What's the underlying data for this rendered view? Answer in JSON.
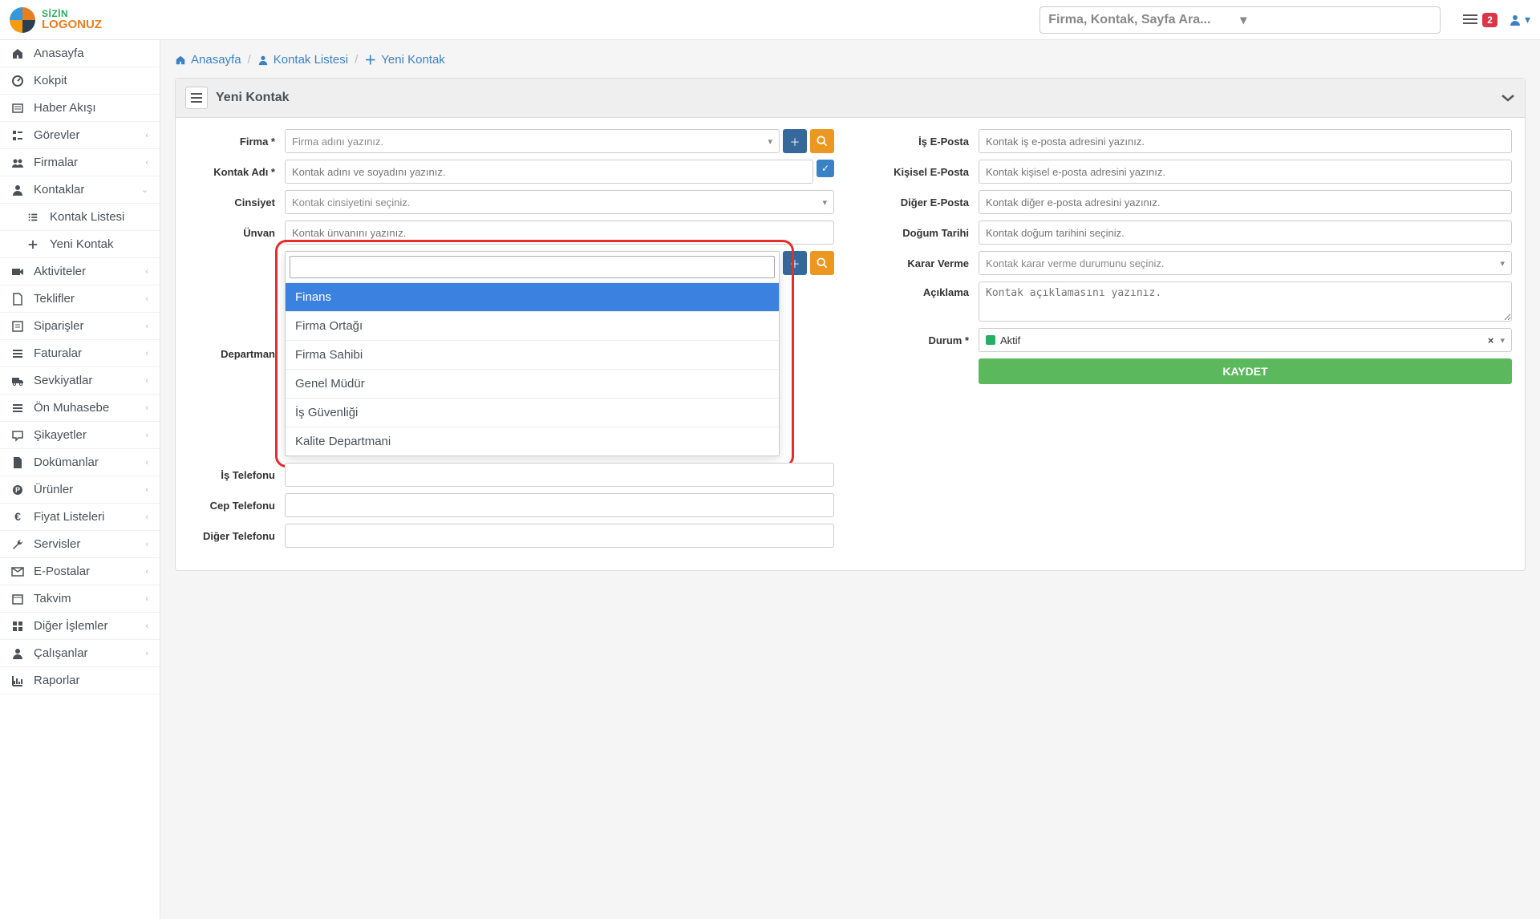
{
  "app": {
    "logo_line1": "SİZİN",
    "logo_line2": "LOGONUZ",
    "search_placeholder": "Firma, Kontak, Sayfa Ara...",
    "notif_count": "2"
  },
  "sidebar": {
    "items": [
      {
        "label": "Anasayfa",
        "icon": "home",
        "expandable": false
      },
      {
        "label": "Kokpit",
        "icon": "dashboard",
        "expandable": false
      },
      {
        "label": "Haber Akışı",
        "icon": "news",
        "expandable": false
      },
      {
        "label": "Görevler",
        "icon": "tasks",
        "expandable": true
      },
      {
        "label": "Firmalar",
        "icon": "users",
        "expandable": true
      },
      {
        "label": "Kontaklar",
        "icon": "user",
        "expandable": true,
        "expanded": true,
        "children": [
          {
            "label": "Kontak Listesi",
            "icon": "list"
          },
          {
            "label": "Yeni Kontak",
            "icon": "plus"
          }
        ]
      },
      {
        "label": "Aktiviteler",
        "icon": "video",
        "expandable": true
      },
      {
        "label": "Teklifler",
        "icon": "doc",
        "expandable": true
      },
      {
        "label": "Siparişler",
        "icon": "order",
        "expandable": true
      },
      {
        "label": "Faturalar",
        "icon": "invoice",
        "expandable": true
      },
      {
        "label": "Sevkiyatlar",
        "icon": "truck",
        "expandable": true
      },
      {
        "label": "Ön Muhasebe",
        "icon": "ledger",
        "expandable": true
      },
      {
        "label": "Şikayetler",
        "icon": "complaint",
        "expandable": true
      },
      {
        "label": "Dokümanlar",
        "icon": "file",
        "expandable": true
      },
      {
        "label": "Ürünler",
        "icon": "product",
        "expandable": true
      },
      {
        "label": "Fiyat Listeleri",
        "icon": "price",
        "expandable": true
      },
      {
        "label": "Servisler",
        "icon": "wrench",
        "expandable": true
      },
      {
        "label": "E-Postalar",
        "icon": "mail",
        "expandable": true
      },
      {
        "label": "Takvim",
        "icon": "calendar",
        "expandable": true
      },
      {
        "label": "Diğer İşlemler",
        "icon": "other",
        "expandable": true
      },
      {
        "label": "Çalışanlar",
        "icon": "staff",
        "expandable": true
      },
      {
        "label": "Raporlar",
        "icon": "chart",
        "expandable": false
      }
    ]
  },
  "breadcrumb": {
    "home": "Anasayfa",
    "list": "Kontak Listesi",
    "new": "Yeni Kontak"
  },
  "panel": {
    "title": "Yeni Kontak",
    "left": {
      "firma_label": "Firma *",
      "firma_placeholder": "Firma adını yazınız.",
      "kontak_adi_label": "Kontak Adı *",
      "kontak_adi_placeholder": "Kontak adını ve soyadını yazınız.",
      "cinsiyet_label": "Cinsiyet",
      "cinsiyet_placeholder": "Kontak cinsiyetini seçiniz.",
      "unvan_label": "Ünvan",
      "unvan_placeholder": "Kontak ünvanını yazınız.",
      "departman_label": "Departman",
      "is_tel_label": "İş Telefonu",
      "cep_tel_label": "Cep Telefonu",
      "diger_tel_label": "Diğer Telefonu"
    },
    "right": {
      "is_eposta_label": "İş E-Posta",
      "is_eposta_placeholder": "Kontak iş e-posta adresini yazınız.",
      "kisisel_eposta_label": "Kişisel E-Posta",
      "kisisel_eposta_placeholder": "Kontak kişisel e-posta adresini yazınız.",
      "diger_eposta_label": "Diğer E-Posta",
      "diger_eposta_placeholder": "Kontak diğer e-posta adresini yazınız.",
      "dogum_label": "Doğum Tarihi",
      "dogum_placeholder": "Kontak doğum tarihini seçiniz.",
      "karar_label": "Karar Verme",
      "karar_placeholder": "Kontak karar verme durumunu seçiniz.",
      "aciklama_label": "Açıklama",
      "aciklama_placeholder": "Kontak açıklamasını yazınız.",
      "durum_label": "Durum *",
      "durum_value": "Aktif",
      "save_label": "KAYDET"
    },
    "departman_dropdown": {
      "options": [
        "Finans",
        "Firma Ortağı",
        "Firma Sahibi",
        "Genel Müdür",
        "İş Güvenliği",
        "Kalite Departmani"
      ],
      "highlighted": 0
    }
  }
}
